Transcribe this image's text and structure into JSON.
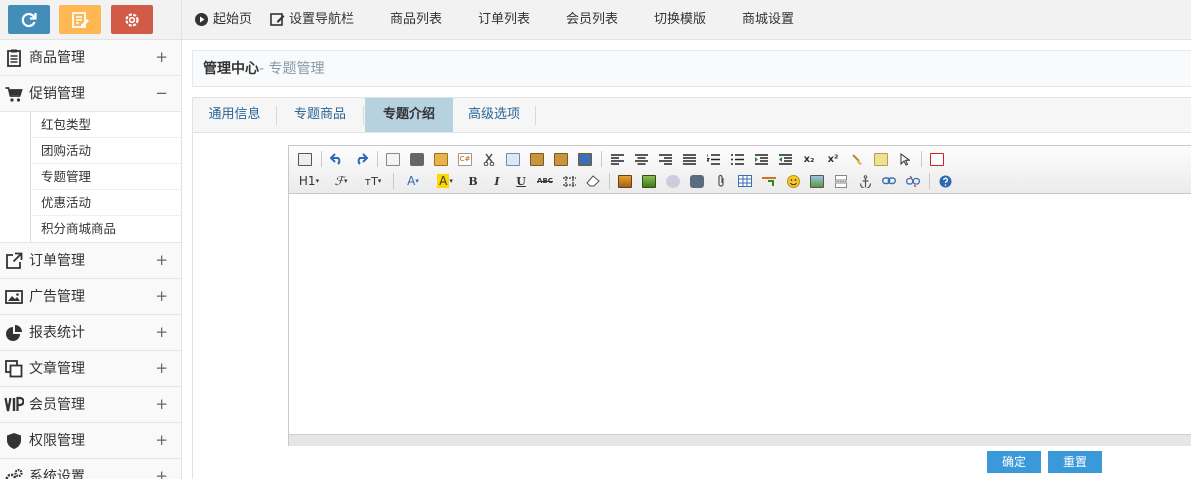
{
  "sidebar": {
    "shortcuts": [
      {
        "icon": "refresh-icon",
        "color": "#438eb9"
      },
      {
        "icon": "edit-icon",
        "color": "#ffb752"
      },
      {
        "icon": "gear-icon",
        "color": "#d15b47"
      }
    ],
    "menu": [
      {
        "label": "商品管理",
        "icon": "clipboard-icon",
        "toggle": "+"
      },
      {
        "label": "促销管理",
        "icon": "cart-icon",
        "toggle": "−",
        "children": [
          "红包类型",
          "团购活动",
          "专题管理",
          "优惠活动",
          "积分商城商品"
        ]
      },
      {
        "label": "订单管理",
        "icon": "external-link-icon",
        "toggle": "+"
      },
      {
        "label": "广告管理",
        "icon": "image-icon",
        "toggle": "+"
      },
      {
        "label": "报表统计",
        "icon": "pie-chart-icon",
        "toggle": "+"
      },
      {
        "label": "文章管理",
        "icon": "copy-icon",
        "toggle": "+"
      },
      {
        "label": "会员管理",
        "icon": "vip-icon",
        "toggle": "+"
      },
      {
        "label": "权限管理",
        "icon": "shield-icon",
        "toggle": "+"
      },
      {
        "label": "系统设置",
        "icon": "cogs-icon",
        "toggle": "+"
      }
    ]
  },
  "topnav": {
    "start": "起始页",
    "set_nav": "设置导航栏",
    "product_list": "商品列表",
    "order_list": "订单列表",
    "member_list": "会员列表",
    "switch_template": "切换模版",
    "shop_settings": "商城设置"
  },
  "breadcrumb": {
    "main": "管理中心",
    "sub": "- 专题管理"
  },
  "tabs": [
    {
      "label": "通用信息",
      "active": false
    },
    {
      "label": "专题商品",
      "active": false
    },
    {
      "label": "专题介绍",
      "active": true
    },
    {
      "label": "高级选项",
      "active": false
    }
  ],
  "editor": {
    "toolbar_text": {
      "heading": "H1",
      "font_size": "тT",
      "font_color": "A",
      "bold": "B",
      "italic": "I",
      "underline": "U",
      "strike": "ABC",
      "subscript": "x₂",
      "superscript": "x²"
    },
    "content": ""
  },
  "buttons": {
    "confirm": "确定",
    "reset": "重置"
  },
  "colors": {
    "accent": "#3a99d8",
    "active_tab": "#b6d1e0",
    "link": "#2a6496"
  }
}
